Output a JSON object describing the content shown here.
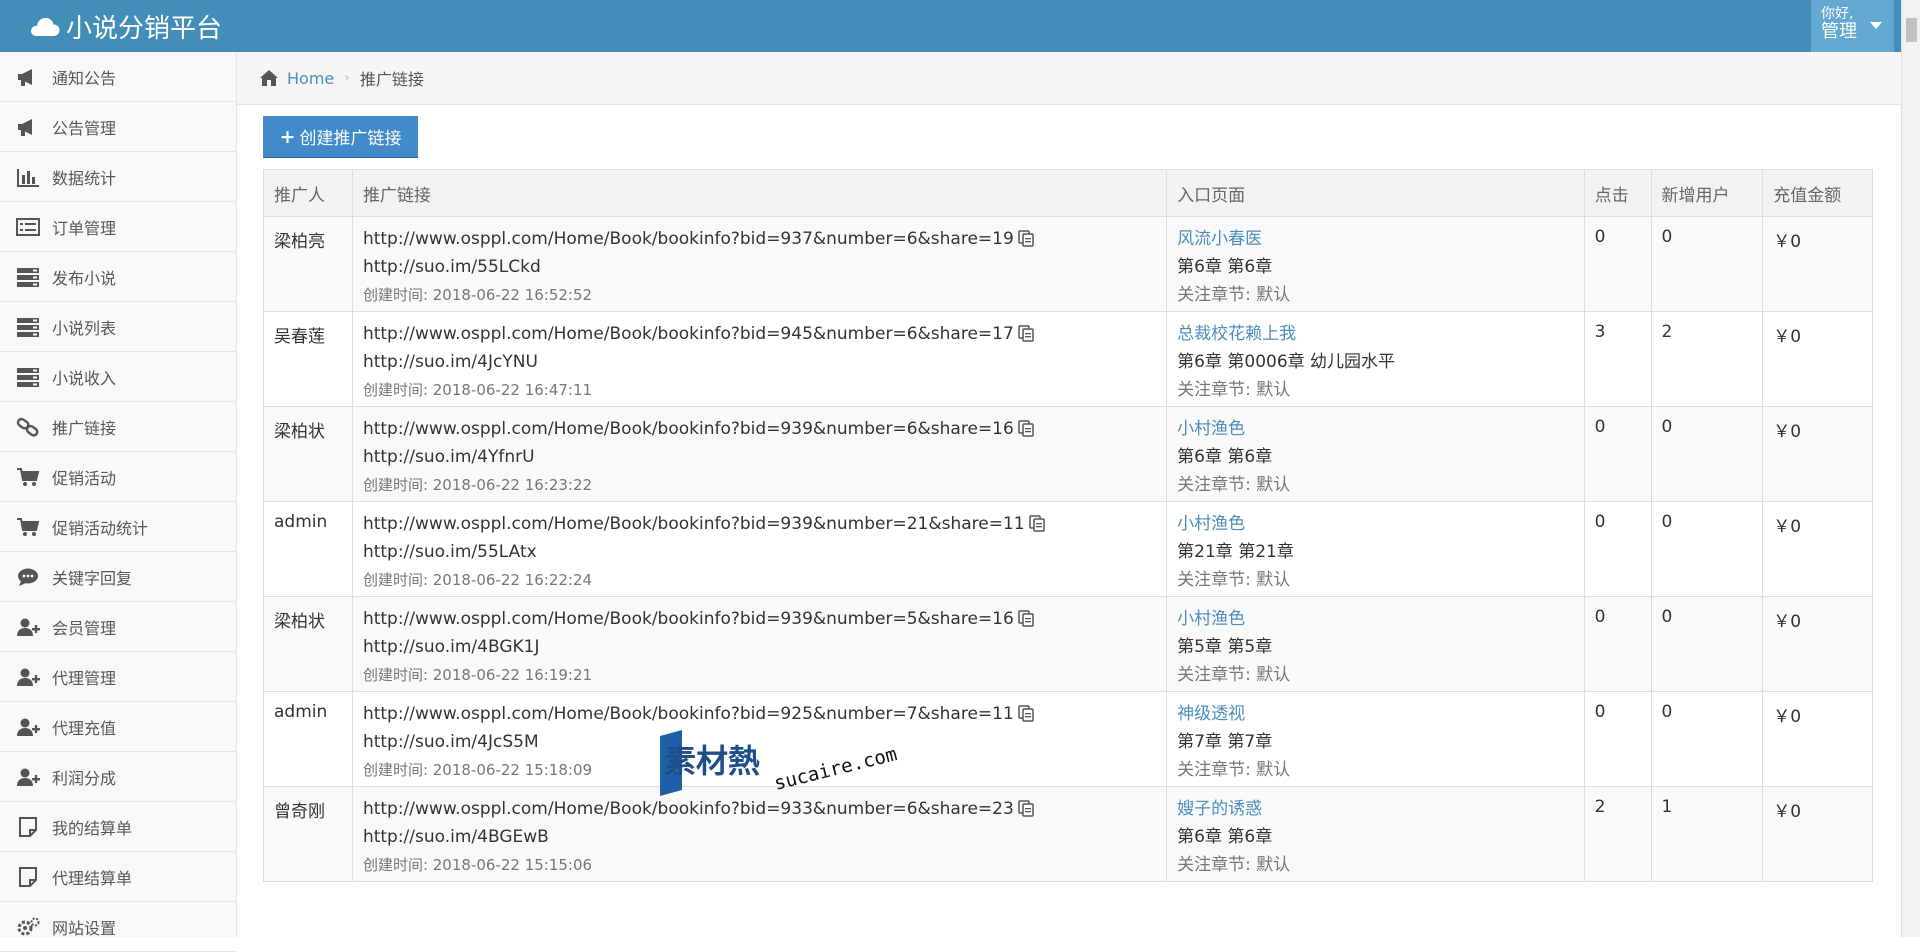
{
  "header": {
    "brand": "小说分销平台",
    "greeting": "你好,",
    "username": "管理"
  },
  "sidebar": {
    "items": [
      {
        "label": "通知公告",
        "icon": "bullhorn-icon"
      },
      {
        "label": "公告管理",
        "icon": "bullhorn-icon"
      },
      {
        "label": "数据统计",
        "icon": "bar-chart-icon"
      },
      {
        "label": "订单管理",
        "icon": "list-icon"
      },
      {
        "label": "发布小说",
        "icon": "server-icon"
      },
      {
        "label": "小说列表",
        "icon": "server-icon"
      },
      {
        "label": "小说收入",
        "icon": "server-icon"
      },
      {
        "label": "推广链接",
        "icon": "link-icon"
      },
      {
        "label": "促销活动",
        "icon": "cart-icon"
      },
      {
        "label": "促销活动统计",
        "icon": "cart-icon"
      },
      {
        "label": "关键字回复",
        "icon": "comments-icon"
      },
      {
        "label": "会员管理",
        "icon": "user-plus-icon"
      },
      {
        "label": "代理管理",
        "icon": "user-plus-icon"
      },
      {
        "label": "代理充值",
        "icon": "user-plus-icon"
      },
      {
        "label": "利润分成",
        "icon": "user-plus-icon"
      },
      {
        "label": "我的结算单",
        "icon": "note-icon"
      },
      {
        "label": "代理结算单",
        "icon": "note-icon"
      },
      {
        "label": "网站设置",
        "icon": "gears-icon"
      }
    ]
  },
  "breadcrumb": {
    "home": "Home",
    "current": "推广链接"
  },
  "toolbar": {
    "create_label": "创建推广链接"
  },
  "table": {
    "headers": [
      "推广人",
      "推广链接",
      "入口页面",
      "点击",
      "新增用户",
      "充值金额"
    ],
    "rows": [
      {
        "promoter": "梁柏亮",
        "url": "http://www.osppl.com/Home/Book/bookinfo?bid=937&number=6&share=19",
        "short": "http://suo.im/55LCkd",
        "created": "创建时间: 2018-06-22 16:52:52",
        "book": "风流小春医",
        "chapter": "第6章 第6章",
        "follow": "关注章节: 默认",
        "clicks": "0",
        "new_users": "0",
        "amount": "￥0"
      },
      {
        "promoter": "吴春莲",
        "url": "http://www.osppl.com/Home/Book/bookinfo?bid=945&number=6&share=17",
        "short": "http://suo.im/4JcYNU",
        "created": "创建时间: 2018-06-22 16:47:11",
        "book": "总裁校花赖上我",
        "chapter": "第6章 第0006章 幼儿园水平",
        "follow": "关注章节: 默认",
        "clicks": "3",
        "new_users": "2",
        "amount": "￥0"
      },
      {
        "promoter": "梁柏状",
        "url": "http://www.osppl.com/Home/Book/bookinfo?bid=939&number=6&share=16",
        "short": "http://suo.im/4YfnrU",
        "created": "创建时间: 2018-06-22 16:23:22",
        "book": "小村渔色",
        "chapter": "第6章 第6章",
        "follow": "关注章节: 默认",
        "clicks": "0",
        "new_users": "0",
        "amount": "￥0"
      },
      {
        "promoter": "admin",
        "url": "http://www.osppl.com/Home/Book/bookinfo?bid=939&number=21&share=11",
        "short": "http://suo.im/55LAtx",
        "created": "创建时间: 2018-06-22 16:22:24",
        "book": "小村渔色",
        "chapter": "第21章 第21章",
        "follow": "关注章节: 默认",
        "clicks": "0",
        "new_users": "0",
        "amount": "￥0"
      },
      {
        "promoter": "梁柏状",
        "url": "http://www.osppl.com/Home/Book/bookinfo?bid=939&number=5&share=16",
        "short": "http://suo.im/4BGK1J",
        "created": "创建时间: 2018-06-22 16:19:21",
        "book": "小村渔色",
        "chapter": "第5章 第5章",
        "follow": "关注章节: 默认",
        "clicks": "0",
        "new_users": "0",
        "amount": "￥0"
      },
      {
        "promoter": "admin",
        "url": "http://www.osppl.com/Home/Book/bookinfo?bid=925&number=7&share=11",
        "short": "http://suo.im/4JcS5M",
        "created": "创建时间: 2018-06-22 15:18:09",
        "book": "神级透视",
        "chapter": "第7章 第7章",
        "follow": "关注章节: 默认",
        "clicks": "0",
        "new_users": "0",
        "amount": "￥0"
      },
      {
        "promoter": "曾奇刚",
        "url": "http://www.osppl.com/Home/Book/bookinfo?bid=933&number=6&share=23",
        "short": "http://suo.im/4BGEwB",
        "created": "创建时间: 2018-06-22 15:15:06",
        "book": "嫂子的诱惑",
        "chapter": "第6章 第6章",
        "follow": "关注章节: 默认",
        "clicks": "2",
        "new_users": "1",
        "amount": "￥0"
      }
    ]
  },
  "watermark": {
    "cn": "素材熱",
    "en": "sucaire.com"
  },
  "colors": {
    "header": "#438eb9",
    "user_box": "#62a8d1",
    "button": "#428bca",
    "link": "#4c8fbd"
  }
}
